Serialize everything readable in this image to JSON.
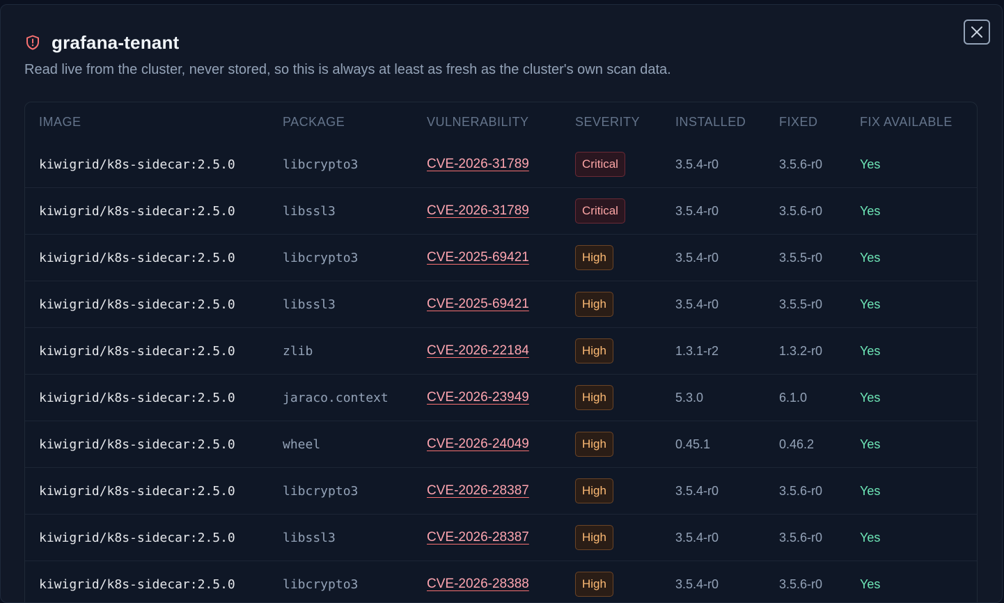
{
  "dialog": {
    "title": "grafana-tenant",
    "subtitle": "Read live from the cluster, never stored, so this is always at least as fresh as the cluster's own scan data.",
    "close_icon": "close-icon",
    "title_icon": "shield-alert-icon"
  },
  "table": {
    "headers": {
      "image": "IMAGE",
      "package": "PACKAGE",
      "vulnerability": "VULNERABILITY",
      "severity": "SEVERITY",
      "installed": "INSTALLED",
      "fixed": "FIXED",
      "fix_available": "FIX AVAILABLE"
    },
    "rows": [
      {
        "image": "kiwigrid/k8s-sidecar:2.5.0",
        "package": "libcrypto3",
        "vulnerability": "CVE-2026-31789",
        "severity": "Critical",
        "installed": "3.5.4-r0",
        "fixed": "3.5.6-r0",
        "fix_available": "Yes"
      },
      {
        "image": "kiwigrid/k8s-sidecar:2.5.0",
        "package": "libssl3",
        "vulnerability": "CVE-2026-31789",
        "severity": "Critical",
        "installed": "3.5.4-r0",
        "fixed": "3.5.6-r0",
        "fix_available": "Yes"
      },
      {
        "image": "kiwigrid/k8s-sidecar:2.5.0",
        "package": "libcrypto3",
        "vulnerability": "CVE-2025-69421",
        "severity": "High",
        "installed": "3.5.4-r0",
        "fixed": "3.5.5-r0",
        "fix_available": "Yes"
      },
      {
        "image": "kiwigrid/k8s-sidecar:2.5.0",
        "package": "libssl3",
        "vulnerability": "CVE-2025-69421",
        "severity": "High",
        "installed": "3.5.4-r0",
        "fixed": "3.5.5-r0",
        "fix_available": "Yes"
      },
      {
        "image": "kiwigrid/k8s-sidecar:2.5.0",
        "package": "zlib",
        "vulnerability": "CVE-2026-22184",
        "severity": "High",
        "installed": "1.3.1-r2",
        "fixed": "1.3.2-r0",
        "fix_available": "Yes"
      },
      {
        "image": "kiwigrid/k8s-sidecar:2.5.0",
        "package": "jaraco.context",
        "vulnerability": "CVE-2026-23949",
        "severity": "High",
        "installed": "5.3.0",
        "fixed": "6.1.0",
        "fix_available": "Yes"
      },
      {
        "image": "kiwigrid/k8s-sidecar:2.5.0",
        "package": "wheel",
        "vulnerability": "CVE-2026-24049",
        "severity": "High",
        "installed": "0.45.1",
        "fixed": "0.46.2",
        "fix_available": "Yes"
      },
      {
        "image": "kiwigrid/k8s-sidecar:2.5.0",
        "package": "libcrypto3",
        "vulnerability": "CVE-2026-28387",
        "severity": "High",
        "installed": "3.5.4-r0",
        "fixed": "3.5.6-r0",
        "fix_available": "Yes"
      },
      {
        "image": "kiwigrid/k8s-sidecar:2.5.0",
        "package": "libssl3",
        "vulnerability": "CVE-2026-28387",
        "severity": "High",
        "installed": "3.5.4-r0",
        "fixed": "3.5.6-r0",
        "fix_available": "Yes"
      },
      {
        "image": "kiwigrid/k8s-sidecar:2.5.0",
        "package": "libcrypto3",
        "vulnerability": "CVE-2026-28388",
        "severity": "High",
        "installed": "3.5.4-r0",
        "fixed": "3.5.6-r0",
        "fix_available": "Yes"
      }
    ]
  },
  "colors": {
    "critical": "#fca5a5",
    "high": "#fdba74",
    "fix_yes": "#6ee7b7",
    "cve_link": "#fda4af",
    "background": "#111827"
  }
}
